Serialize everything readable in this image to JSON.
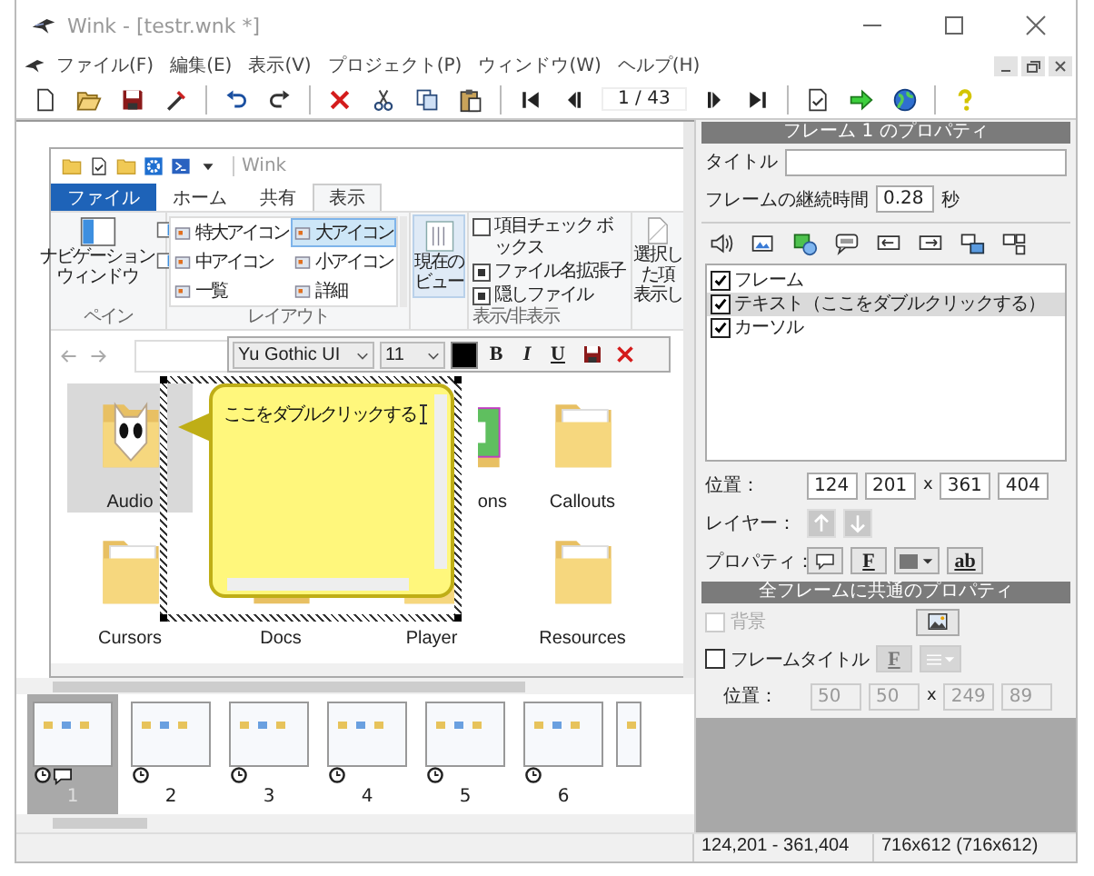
{
  "window": {
    "title": "Wink - [testr.wnk *]"
  },
  "menu": [
    "ファイル(F)",
    "編集(E)",
    "表示(V)",
    "プロジェクト(P)",
    "ウィンドウ(W)",
    "ヘルプ(H)"
  ],
  "toolbar": {
    "frame_counter": "1 / 43"
  },
  "embedded_screenshot": {
    "title": "Wink",
    "ribbon_tabs": [
      {
        "label": "ファイル",
        "kind": "file",
        "selected": false
      },
      {
        "label": "ホーム",
        "kind": "tab",
        "selected": false
      },
      {
        "label": "共有",
        "kind": "tab",
        "selected": false
      },
      {
        "label": "表示",
        "kind": "tab",
        "selected": true
      }
    ],
    "pane_button": [
      "ナビゲーション",
      "ウィンドウ"
    ],
    "pane_group": "ペイン",
    "layout_options": [
      {
        "label": "特大アイコン",
        "selected": false
      },
      {
        "label": "大アイコン",
        "selected": true
      },
      {
        "label": "中アイコン",
        "selected": false
      },
      {
        "label": "小アイコン",
        "selected": false
      },
      {
        "label": "一覧",
        "selected": false
      },
      {
        "label": "詳細",
        "selected": false
      }
    ],
    "layout_group": "レイアウト",
    "current_view": [
      "現在の",
      "ビュー"
    ],
    "show_hide": [
      {
        "label": "項目チェック ボックス",
        "checked": false
      },
      {
        "label": "ファイル名拡張子",
        "checked": true
      },
      {
        "label": "隠しファイル",
        "checked": true
      }
    ],
    "show_hide_group": "表示/非表示",
    "selected_items_button": [
      "選択した項",
      "表示し"
    ],
    "folders": [
      {
        "label": "Audio",
        "kind": "audio",
        "selected": true
      },
      {
        "label": "ons",
        "kind": "green",
        "selected": false
      },
      {
        "label": "Callouts",
        "kind": "plain",
        "selected": false
      },
      {
        "label": "Cursors",
        "kind": "plain",
        "selected": false
      },
      {
        "label": "Docs",
        "kind": "pdf",
        "selected": false
      },
      {
        "label": "Player",
        "kind": "plain",
        "selected": false
      },
      {
        "label": "Resources",
        "kind": "plain",
        "selected": false
      }
    ]
  },
  "text_toolbar": {
    "font": "Yu Gothic UI",
    "size": "11",
    "buttons": [
      {
        "kind": "bold",
        "label": "B"
      },
      {
        "kind": "italic",
        "label": "I"
      },
      {
        "kind": "underline",
        "label": "U"
      },
      {
        "kind": "save"
      },
      {
        "kind": "close"
      }
    ]
  },
  "callout": {
    "text": "ここをダブルクリックする"
  },
  "thumbnails": [
    {
      "number": "1",
      "kind": "full",
      "selected": true,
      "has_text": true
    },
    {
      "number": "2",
      "kind": "full",
      "selected": false,
      "has_text": false
    },
    {
      "number": "3",
      "kind": "full",
      "selected": false,
      "has_text": false
    },
    {
      "number": "4",
      "kind": "full",
      "selected": false,
      "has_text": false
    },
    {
      "number": "5",
      "kind": "full",
      "selected": false,
      "has_text": false
    },
    {
      "number": "6",
      "kind": "full",
      "selected": false,
      "has_text": false
    },
    {
      "kind": "partial",
      "selected": false
    }
  ],
  "frame_properties": {
    "header": "フレーム 1 のプロパティ",
    "title_label": "タイトル",
    "duration_label": "フレームの継続時間",
    "duration": "0.28",
    "duration_unit": "秒",
    "objects": [
      {
        "label": "フレーム",
        "checked": true,
        "selected": false
      },
      {
        "label": "テキスト（ここをダブルクリックする）",
        "checked": true,
        "selected": true
      },
      {
        "label": "カーソル",
        "checked": true,
        "selected": false
      }
    ],
    "position_label": "位置：",
    "position": {
      "values": [
        "124",
        "201",
        "361",
        "404"
      ],
      "separator": "x",
      "disabled": false
    },
    "layer_label": "レイヤー：",
    "layer_buttons": [
      {
        "kind": "up",
        "disabled": true
      },
      {
        "kind": "down",
        "disabled": true
      }
    ],
    "properties_label": "プロパティ：",
    "property_buttons": [
      {
        "kind": "shape"
      },
      {
        "kind": "font",
        "label": "F"
      },
      {
        "kind": "color"
      },
      {
        "kind": "text",
        "label": "ab"
      }
    ]
  },
  "common_properties": {
    "header": "全フレームに共通のプロパティ",
    "background": {
      "label": "背景",
      "checked": false,
      "disabled": true
    },
    "frame_title": {
      "label": "フレームタイトル",
      "checked": false,
      "disabled": false
    },
    "title_font_button": {
      "label": "F",
      "disabled": true
    },
    "align_dropdown": {
      "disabled": true
    },
    "position_label": "位置：",
    "position": {
      "values": [
        "50",
        "50",
        "249",
        "89"
      ],
      "separator": "x",
      "disabled": true
    }
  },
  "status_bar": [
    "124,201 - 361,404",
    "716x612 (716x612)"
  ]
}
